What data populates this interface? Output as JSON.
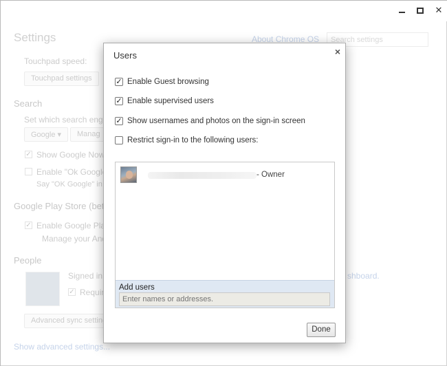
{
  "window": {
    "minimize": "—",
    "maximize": "☐",
    "close": "✕"
  },
  "settings": {
    "title": "Settings",
    "about_link": "About Chrome OS",
    "search_placeholder": "Search settings",
    "touchpad_speed": "Touchpad speed:",
    "touchpad_settings_button": "Touchpad settings",
    "search_heading": "Search",
    "search_engine_text": "Set which search engine i",
    "google_dropdown": "Google",
    "manage_button": "Manag",
    "show_google_now": "Show Google Now ca",
    "enable_ok_google": "Enable \"Ok Google\" to",
    "say_ok_google": "Say \"OK Google\" in a",
    "play_store_heading": "Google Play Store (beta)",
    "enable_google_play": "Enable Google Play S",
    "manage_android": "Manage your Andro",
    "people_heading": "People",
    "signed_in": "Signed in a",
    "dashboard_link": "shboard.",
    "require": "Require",
    "advanced_sync": "Advanced sync settings",
    "show_advanced": "Show advanced settings..."
  },
  "dialog": {
    "title": "Users",
    "close": "×",
    "options": [
      {
        "label": "Enable Guest browsing",
        "checked": true
      },
      {
        "label": "Enable supervised users",
        "checked": true
      },
      {
        "label": "Show usernames and photos on the sign-in screen",
        "checked": true
      },
      {
        "label": "Restrict sign-in to the following users:",
        "checked": false
      }
    ],
    "owner_label": "- Owner",
    "add_users_label": "Add users",
    "add_users_placeholder": "Enter names or addresses.",
    "done_button": "Done"
  }
}
